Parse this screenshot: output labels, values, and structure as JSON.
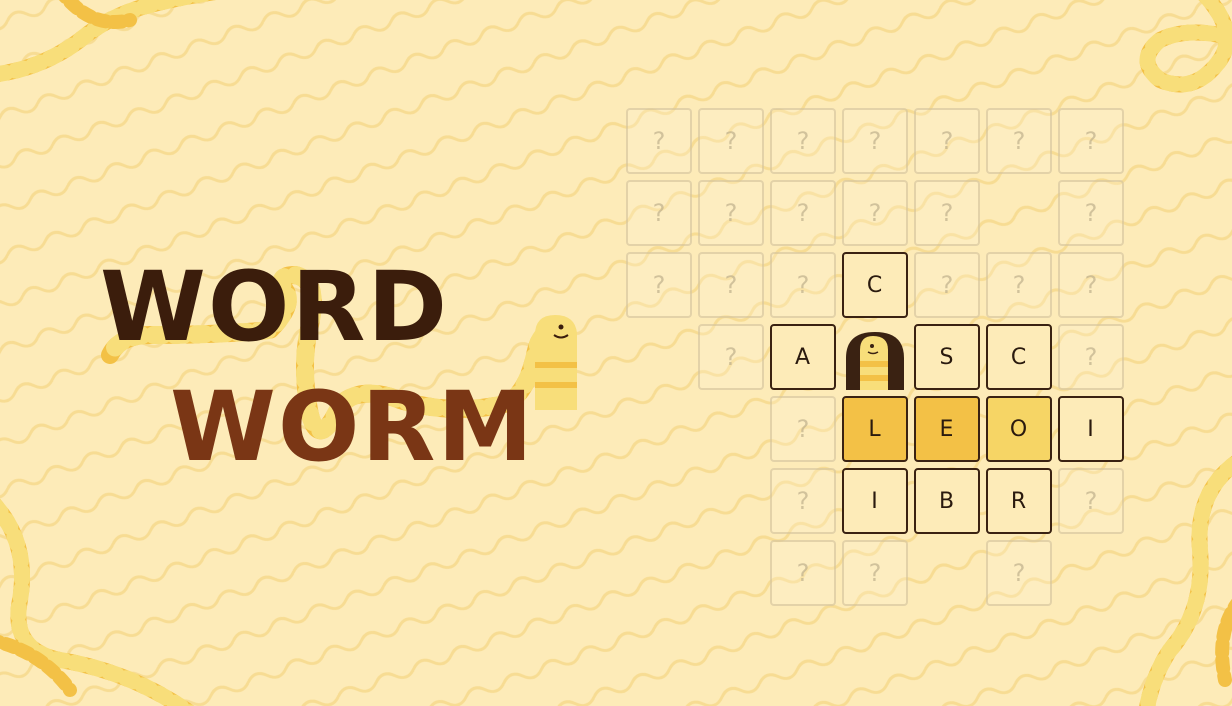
{
  "game": {
    "title_line1": "WORD",
    "title_line2": "WORM",
    "hidden_glyph": "?"
  },
  "board": {
    "cols": 7,
    "rows": 7,
    "cells": [
      {
        "r": 0,
        "c": 0,
        "state": "hidden"
      },
      {
        "r": 0,
        "c": 1,
        "state": "hidden"
      },
      {
        "r": 0,
        "c": 2,
        "state": "hidden"
      },
      {
        "r": 0,
        "c": 3,
        "state": "hidden"
      },
      {
        "r": 0,
        "c": 4,
        "state": "hidden"
      },
      {
        "r": 0,
        "c": 5,
        "state": "hidden"
      },
      {
        "r": 0,
        "c": 6,
        "state": "hidden"
      },
      {
        "r": 1,
        "c": 0,
        "state": "hidden"
      },
      {
        "r": 1,
        "c": 1,
        "state": "hidden"
      },
      {
        "r": 1,
        "c": 2,
        "state": "hidden"
      },
      {
        "r": 1,
        "c": 3,
        "state": "hidden"
      },
      {
        "r": 1,
        "c": 4,
        "state": "hidden"
      },
      {
        "r": 1,
        "c": 6,
        "state": "hidden"
      },
      {
        "r": 2,
        "c": 0,
        "state": "hidden"
      },
      {
        "r": 2,
        "c": 1,
        "state": "hidden"
      },
      {
        "r": 2,
        "c": 2,
        "state": "hidden"
      },
      {
        "r": 2,
        "c": 3,
        "state": "letter",
        "letter": "C"
      },
      {
        "r": 2,
        "c": 4,
        "state": "hidden"
      },
      {
        "r": 2,
        "c": 5,
        "state": "hidden"
      },
      {
        "r": 2,
        "c": 6,
        "state": "hidden"
      },
      {
        "r": 3,
        "c": 1,
        "state": "hidden"
      },
      {
        "r": 3,
        "c": 2,
        "state": "letter",
        "letter": "A"
      },
      {
        "r": 3,
        "c": 3,
        "state": "worm"
      },
      {
        "r": 3,
        "c": 4,
        "state": "letter",
        "letter": "S"
      },
      {
        "r": 3,
        "c": 5,
        "state": "letter",
        "letter": "C"
      },
      {
        "r": 3,
        "c": 6,
        "state": "hidden"
      },
      {
        "r": 4,
        "c": 2,
        "state": "hidden"
      },
      {
        "r": 4,
        "c": 3,
        "state": "selected",
        "letter": "L"
      },
      {
        "r": 4,
        "c": 4,
        "state": "selected",
        "letter": "E"
      },
      {
        "r": 4,
        "c": 5,
        "state": "selected-light",
        "letter": "O"
      },
      {
        "r": 4,
        "c": 6,
        "state": "letter",
        "letter": "I"
      },
      {
        "r": 5,
        "c": 2,
        "state": "hidden"
      },
      {
        "r": 5,
        "c": 3,
        "state": "letter",
        "letter": "I"
      },
      {
        "r": 5,
        "c": 4,
        "state": "letter",
        "letter": "B"
      },
      {
        "r": 5,
        "c": 5,
        "state": "letter",
        "letter": "R"
      },
      {
        "r": 5,
        "c": 6,
        "state": "hidden"
      },
      {
        "r": 6,
        "c": 2,
        "state": "hidden"
      },
      {
        "r": 6,
        "c": 3,
        "state": "hidden"
      },
      {
        "r": 6,
        "c": 5,
        "state": "hidden"
      }
    ]
  },
  "colors": {
    "background": "#fdebb8",
    "wave": "#f7dc93",
    "title_dark": "#3b1d0c",
    "title_brown": "#7a3615",
    "worm_yellow": "#f3c146",
    "worm_light": "#f8de7a",
    "tile_selected": "#f3c146",
    "tile_border": "#3a2212"
  }
}
